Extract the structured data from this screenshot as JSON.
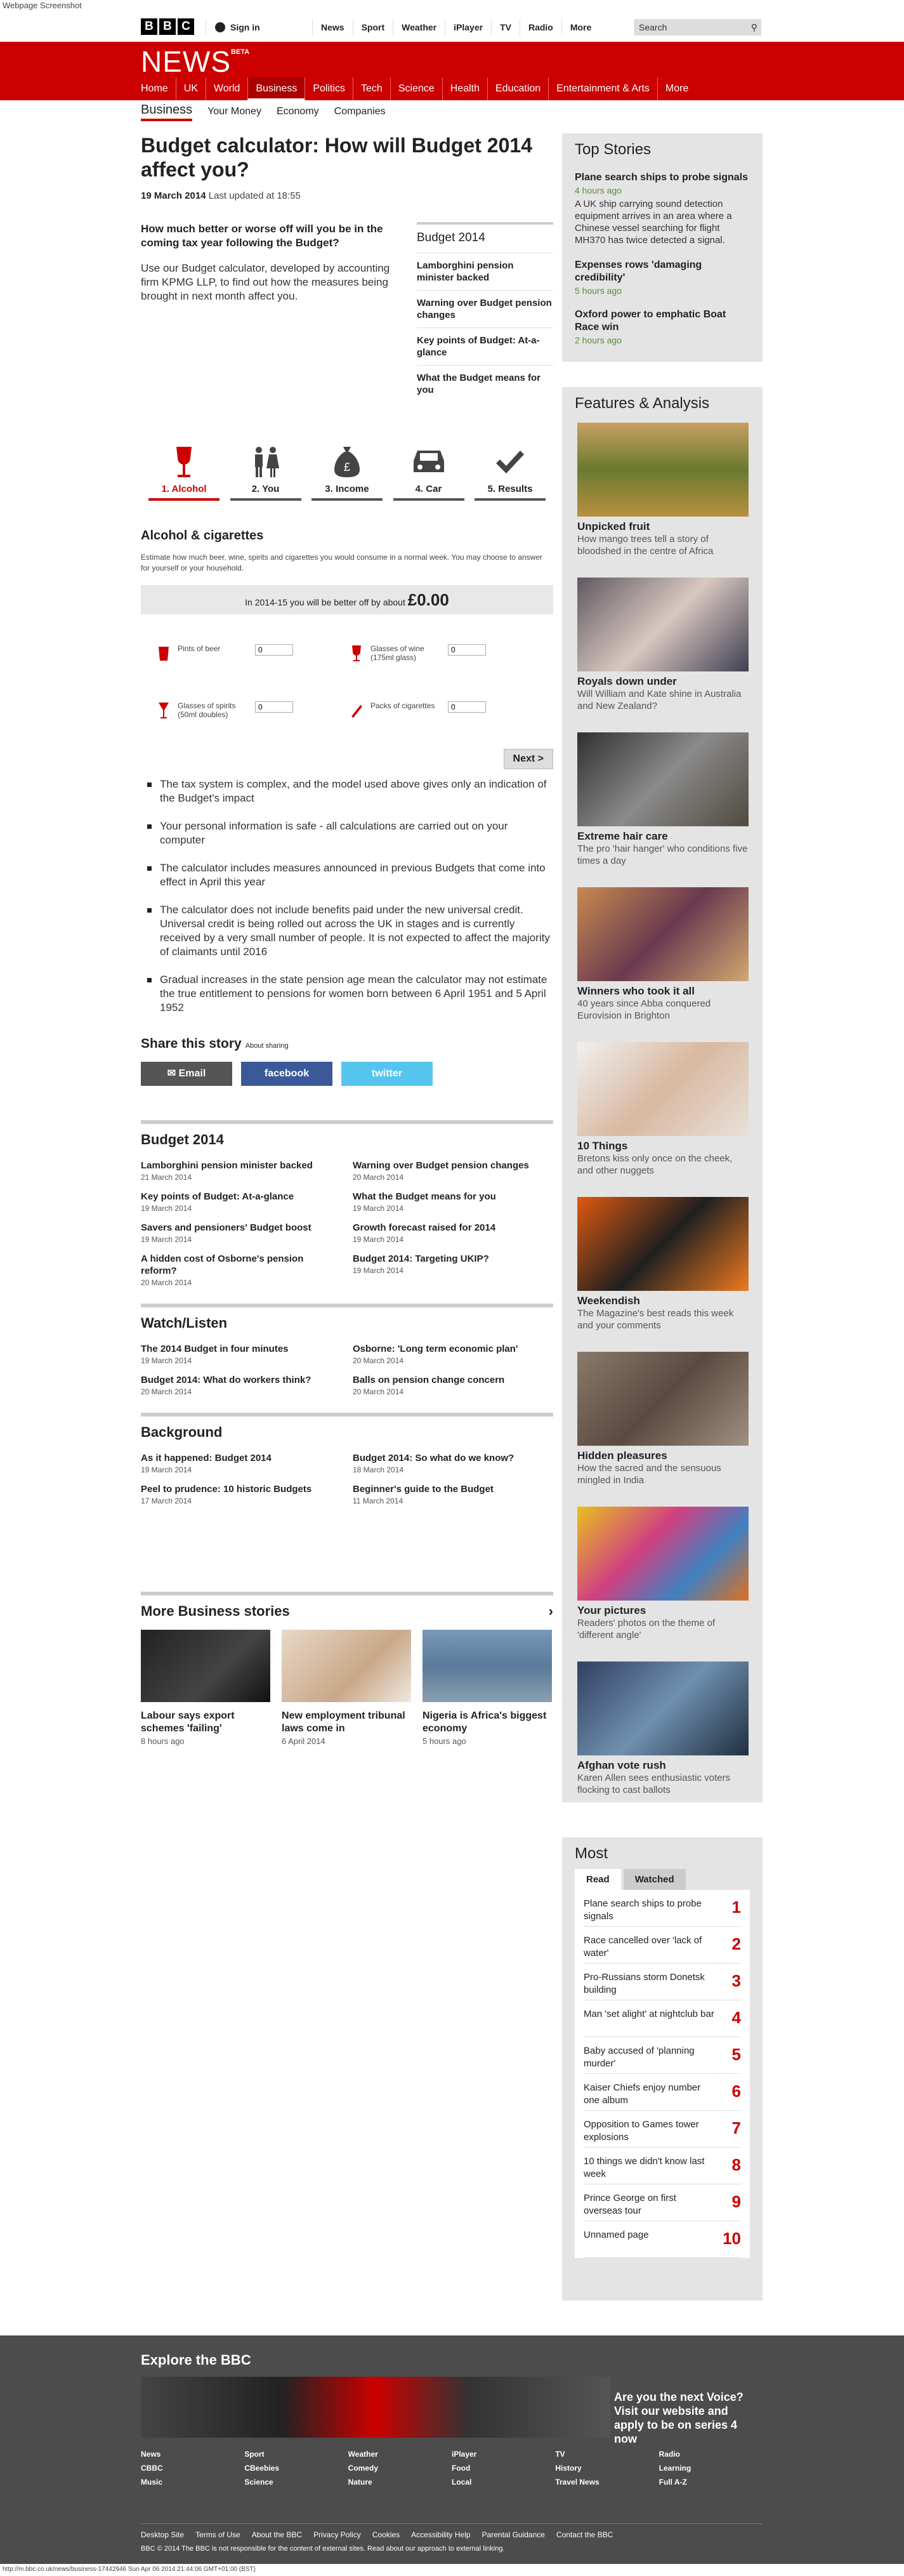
{
  "screenshot_label": "Webpage Screenshot",
  "header": {
    "sign_in": "Sign in",
    "nav": [
      "News",
      "Sport",
      "Weather",
      "iPlayer",
      "TV",
      "Radio",
      "More"
    ],
    "search_placeholder": "Search"
  },
  "news_bar": {
    "title": "NEWS",
    "badge": "BETA",
    "nav": [
      "Home",
      "UK",
      "World",
      "Business",
      "Politics",
      "Tech",
      "Science",
      "Health",
      "Education",
      "Entertainment & Arts",
      "More"
    ],
    "active": "Business"
  },
  "subnav": [
    "Business",
    "Your Money",
    "Economy",
    "Companies"
  ],
  "article": {
    "title": "Budget calculator: How will Budget 2014 affect you?",
    "date": "19 March 2014",
    "updated": "Last updated at 18:55",
    "question": "How much better or worse off will you be in the coming tax year following the Budget?",
    "intro": "Use our Budget calculator, developed by accounting firm KPMG LLP, to find out how the measures being brought in next month affect you."
  },
  "budget_box": {
    "title": "Budget 2014",
    "links": [
      "Lamborghini pension minister backed",
      "Warning over Budget pension changes",
      "Key points of Budget: At-a-glance",
      "What the Budget means for you"
    ]
  },
  "calculator": {
    "tabs": [
      "1. Alcohol",
      "2. You",
      "3. Income",
      "4. Car",
      "5. Results"
    ],
    "heading": "Alcohol & cigarettes",
    "desc": "Estimate how much beer, wine, spirits and cigarettes you would consume in a normal week. You may choose to answer for yourself or your household.",
    "better_text": "In 2014-15 you will be better off by about",
    "better_value": "£0.00",
    "fields": {
      "beer": "Pints of beer",
      "wine": "Glasses of wine (175ml glass)",
      "spirits": "Glasses of spirits (50ml doubles)",
      "cigarettes": "Packs of cigarettes"
    },
    "field_value": "0",
    "next": "Next >"
  },
  "notes": [
    "The tax system is complex, and the model used above gives only an indication of the Budget's impact",
    "Your personal information is safe - all calculations are carried out on your computer",
    "The calculator includes measures announced in previous Budgets that come into effect in April this year",
    "The calculator does not include benefits paid under the new universal credit. Universal credit is being rolled out across the UK in stages and is currently received by a very small number of people. It is not expected to affect the majority of claimants until 2016",
    "Gradual increases in the state pension age mean the calculator may not estimate the true entitlement to pensions for women born between 6 April 1951 and 5 April 1952"
  ],
  "share": {
    "title": "Share this story",
    "about": "About sharing",
    "email": "Email",
    "facebook": "facebook",
    "twitter": "twitter"
  },
  "sections": {
    "budget": {
      "title": "Budget 2014",
      "items": [
        {
          "t": "Lamborghini pension minister backed",
          "d": "21 March 2014"
        },
        {
          "t": "Warning over Budget pension changes",
          "d": "20 March 2014"
        },
        {
          "t": "Key points of Budget: At-a-glance",
          "d": "19 March 2014"
        },
        {
          "t": "What the Budget means for you",
          "d": "19 March 2014"
        },
        {
          "t": "Savers and pensioners' Budget boost",
          "d": "19 March 2014"
        },
        {
          "t": "Growth forecast raised for 2014",
          "d": "19 March 2014"
        },
        {
          "t": "A hidden cost of Osborne's pension reform?",
          "d": "20 March 2014"
        },
        {
          "t": "Budget 2014: Targeting UKIP?",
          "d": "19 March 2014"
        }
      ]
    },
    "watch": {
      "title": "Watch/Listen",
      "items": [
        {
          "t": "The 2014 Budget in four minutes",
          "d": "19 March 2014"
        },
        {
          "t": "Osborne: 'Long term economic plan'",
          "d": "20 March 2014"
        },
        {
          "t": "Budget 2014: What do workers think?",
          "d": "20 March 2014"
        },
        {
          "t": "Balls on pension change concern",
          "d": "20 March 2014"
        }
      ]
    },
    "background": {
      "title": "Background",
      "items": [
        {
          "t": "As it happened: Budget 2014",
          "d": "19 March 2014"
        },
        {
          "t": "Budget 2014: So what do we know?",
          "d": "18 March 2014"
        },
        {
          "t": "Peel to prudence: 10 historic Budgets",
          "d": "17 March 2014"
        },
        {
          "t": "Beginner's guide to the Budget",
          "d": "11 March 2014"
        }
      ]
    }
  },
  "more_business": {
    "title": "More Business stories",
    "items": [
      {
        "t": "Labour says export schemes 'failing'",
        "d": "8 hours ago"
      },
      {
        "t": "New employment tribunal laws come in",
        "d": "6 April 2014"
      },
      {
        "t": "Nigeria is Africa's biggest economy",
        "d": "5 hours ago"
      }
    ]
  },
  "top_stories": {
    "title": "Top Stories",
    "items": [
      {
        "t": "Plane search ships to probe signals",
        "d": "4 hours ago",
        "s": "A UK ship carrying sound detection equipment arrives in an area where a Chinese vessel searching for flight MH370 has twice detected a signal."
      },
      {
        "t": "Expenses rows 'damaging credibility'",
        "d": "5 hours ago"
      },
      {
        "t": "Oxford power to emphatic Boat Race win",
        "d": "2 hours ago"
      }
    ]
  },
  "features": {
    "title": "Features & Analysis",
    "items": [
      {
        "t": "Unpicked fruit",
        "s": "How mango trees tell a story of bloodshed in the centre of Africa"
      },
      {
        "t": "Royals down under",
        "s": "Will William and Kate shine in Australia and New Zealand?"
      },
      {
        "t": "Extreme hair care",
        "s": "The pro 'hair hanger' who conditions five times a day"
      },
      {
        "t": "Winners who took it all",
        "s": "40 years since Abba conquered Eurovision in Brighton"
      },
      {
        "t": "10 Things",
        "s": "Bretons kiss only once on the cheek, and other nuggets"
      },
      {
        "t": "Weekendish",
        "s": "The Magazine's best reads this week and your comments"
      },
      {
        "t": "Hidden pleasures",
        "s": "How the sacred and the sensuous mingled in India"
      },
      {
        "t": "Your pictures",
        "s": "Readers' photos on the theme of 'different angle'"
      },
      {
        "t": "Afghan vote rush",
        "s": "Karen Allen sees enthusiastic voters flocking to cast ballots"
      }
    ]
  },
  "most": {
    "title": "Most",
    "tabs": [
      "Read",
      "Watched"
    ],
    "items": [
      "Plane search ships to probe signals",
      "Race cancelled over 'lack of water'",
      "Pro-Russians storm Donetsk building",
      "Man 'set alight' at nightclub bar",
      "Baby accused of 'planning murder'",
      "Kaiser Chiefs enjoy number one album",
      "Opposition to Games tower explosions",
      "10 things we didn't know last week",
      "Prince George on first overseas tour",
      "Unnamed page"
    ]
  },
  "explore": {
    "title": "Explore the BBC",
    "promo": "Are you the next Voice? Visit our website and apply to be on series 4 now",
    "links": [
      "News",
      "Sport",
      "Weather",
      "iPlayer",
      "TV",
      "Radio",
      "CBBC",
      "CBeebies",
      "Comedy",
      "Food",
      "History",
      "Learning",
      "Music",
      "Science",
      "Nature",
      "Local",
      "Travel News",
      "Full A-Z"
    ],
    "footer": [
      "Desktop Site",
      "Terms of Use",
      "About the BBC",
      "Privacy Policy",
      "Cookies",
      "Accessibility Help",
      "Parental Guidance",
      "Contact the BBC"
    ],
    "copyright": "BBC © 2014 The BBC is not responsible for the content of external sites. Read about our approach to external linking."
  },
  "statusbar": "http://m.bbc.co.uk/news/business-17442946 Sun Apr 06 2014 21:44:06 GMT+01:00 (BST)"
}
